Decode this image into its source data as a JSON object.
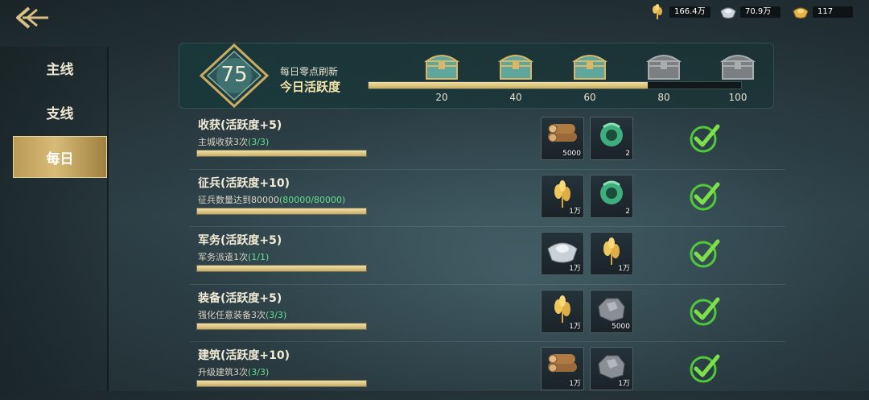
{
  "resources": [
    {
      "name": "grain",
      "icon": "wheat-icon",
      "value": "166.4万"
    },
    {
      "name": "silver",
      "icon": "silver-ingot-icon",
      "value": "70.9万"
    },
    {
      "name": "gold",
      "icon": "gold-ingot-icon",
      "value": "117"
    }
  ],
  "sidebar": {
    "tabs": [
      {
        "label": "主线",
        "active": false
      },
      {
        "label": "支线",
        "active": false
      },
      {
        "label": "每日",
        "active": true
      }
    ]
  },
  "activity": {
    "score": "75",
    "subtitle": "每日零点刷新",
    "title": "今日活跃度",
    "progress_fraction": 0.75,
    "milestones": [
      {
        "value": "20",
        "state": "available"
      },
      {
        "value": "40",
        "state": "available"
      },
      {
        "value": "60",
        "state": "available"
      },
      {
        "value": "80",
        "state": "locked"
      },
      {
        "value": "100",
        "state": "locked"
      }
    ]
  },
  "tasks": [
    {
      "title": "收获(活跃度+5)",
      "desc": "主城收获3次",
      "progress": "(3/3)",
      "fraction": 1,
      "rewards": [
        {
          "icon": "wood-log-icon",
          "qty": "5000"
        },
        {
          "icon": "jade-dragon-icon",
          "qty": "2"
        }
      ],
      "completed": true
    },
    {
      "title": "征兵(活跃度+10)",
      "desc": "征兵数量达到80000",
      "progress": "(80000/80000)",
      "fraction": 1,
      "rewards": [
        {
          "icon": "wheat-icon",
          "qty": "1万"
        },
        {
          "icon": "jade-dragon-icon",
          "qty": "2"
        }
      ],
      "completed": true
    },
    {
      "title": "军务(活跃度+5)",
      "desc": "军务派遣1次",
      "progress": "(1/1)",
      "fraction": 1,
      "rewards": [
        {
          "icon": "silver-ingot-icon",
          "qty": "1万"
        },
        {
          "icon": "wheat-icon",
          "qty": "1万"
        }
      ],
      "completed": true
    },
    {
      "title": "装备(活跃度+5)",
      "desc": "强化任意装备3次",
      "progress": "(3/3)",
      "fraction": 1,
      "rewards": [
        {
          "icon": "wheat-icon",
          "qty": "1万"
        },
        {
          "icon": "stone-ore-icon",
          "qty": "5000"
        }
      ],
      "completed": true
    },
    {
      "title": "建筑(活跃度+10)",
      "desc": "升级建筑3次",
      "progress": "(3/3)",
      "fraction": 1,
      "rewards": [
        {
          "icon": "wood-log-icon",
          "qty": "1万"
        },
        {
          "icon": "stone-ore-icon",
          "qty": "1万"
        }
      ],
      "completed": true
    }
  ],
  "colors": {
    "gold": "#d7bb78",
    "progress_green": "#63e08d",
    "check_green": "#4fc93a"
  }
}
